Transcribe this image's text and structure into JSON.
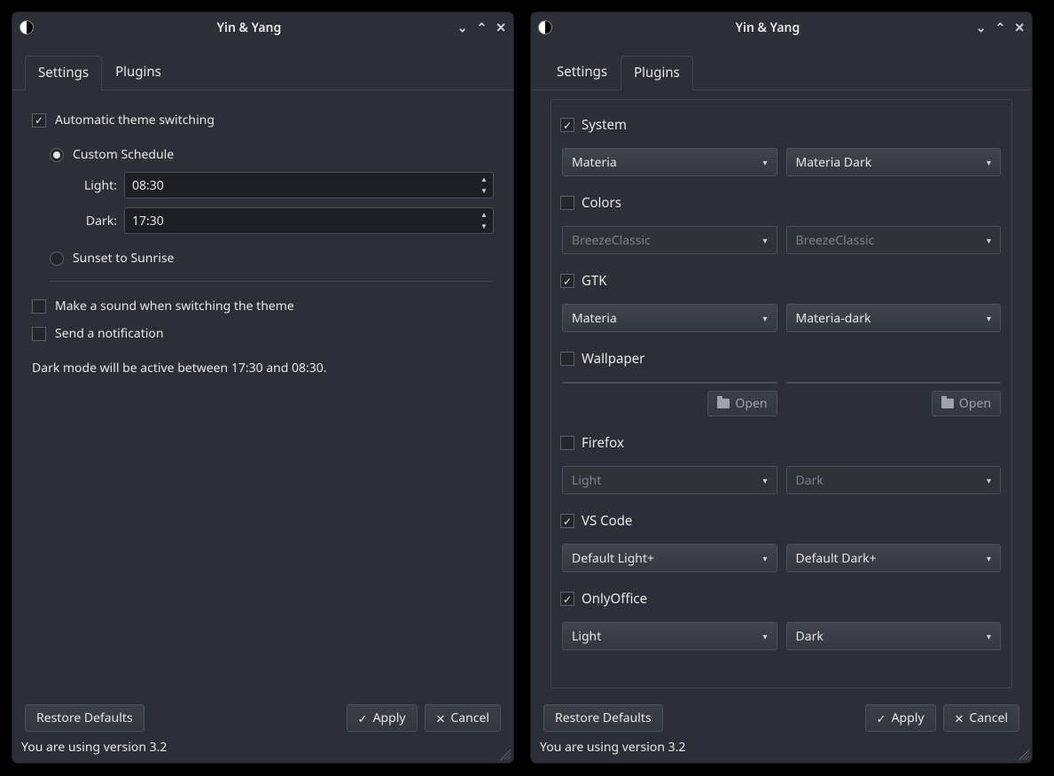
{
  "window": {
    "title": "Yin & Yang"
  },
  "tabs": {
    "settings": "Settings",
    "plugins": "Plugins"
  },
  "settings": {
    "auto_switch_label": "Automatic theme switching",
    "custom_schedule_label": "Custom Schedule",
    "light_label": "Light:",
    "dark_label": "Dark:",
    "light_time": "08:30",
    "dark_time": "17:30",
    "sunset_label": "Sunset to Sunrise",
    "sound_label": "Make a sound when switching the theme",
    "notify_label": "Send a notification",
    "info": "Dark mode will be active between 17:30 and 08:30."
  },
  "plugins": {
    "system": {
      "label": "System",
      "checked": true,
      "light": "Materia",
      "dark": "Materia Dark"
    },
    "colors": {
      "label": "Colors",
      "checked": false,
      "light": "BreezeClassic",
      "dark": "BreezeClassic"
    },
    "gtk": {
      "label": "GTK",
      "checked": true,
      "light": "Materia",
      "dark": "Materia-dark"
    },
    "wallpaper": {
      "label": "Wallpaper",
      "checked": false,
      "open": "Open"
    },
    "firefox": {
      "label": "Firefox",
      "checked": false,
      "light": "Light",
      "dark": "Dark"
    },
    "vscode": {
      "label": "VS Code",
      "checked": true,
      "light": "Default Light+",
      "dark": "Default Dark+"
    },
    "onlyoffice": {
      "label": "OnlyOffice",
      "checked": true,
      "light": "Light",
      "dark": "Dark"
    }
  },
  "buttons": {
    "restore": "Restore Defaults",
    "apply": "Apply",
    "cancel": "Cancel"
  },
  "status": "You are using version 3.2"
}
